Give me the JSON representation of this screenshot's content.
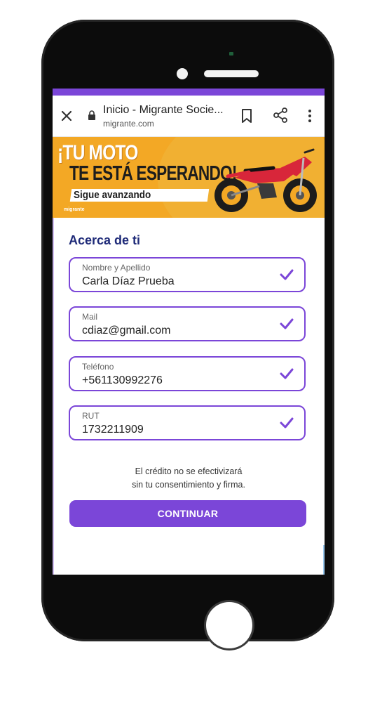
{
  "browser": {
    "title": "Inicio - Migrante Socie...",
    "url": "migrante.com"
  },
  "banner": {
    "headline_1": "¡TU MOTO",
    "headline_2": "TE ESTÁ ESPERANDO!",
    "subline": "Sigue avanzando",
    "brand": "migrante"
  },
  "form": {
    "section_title": "Acerca de ti",
    "fields": [
      {
        "label": "Nombre y Apellido",
        "value": "Carla Díaz Prueba"
      },
      {
        "label": "Mail",
        "value": "cdiaz@gmail.com"
      },
      {
        "label": "Teléfono",
        "value": "+561130992276"
      },
      {
        "label": "RUT",
        "value": "1732211909"
      }
    ],
    "notice_line_1": "El crédito no se efectivizará",
    "notice_line_2": "sin tu consentimiento y firma.",
    "continue_label": "CONTINUAR"
  },
  "colors": {
    "accent": "#7b46d8",
    "heading": "#1e2a78",
    "banner_bg": "#f3a825"
  },
  "icons": [
    "close-icon",
    "lock-icon",
    "bookmark-icon",
    "share-icon",
    "more-vert-icon",
    "check-icon"
  ]
}
